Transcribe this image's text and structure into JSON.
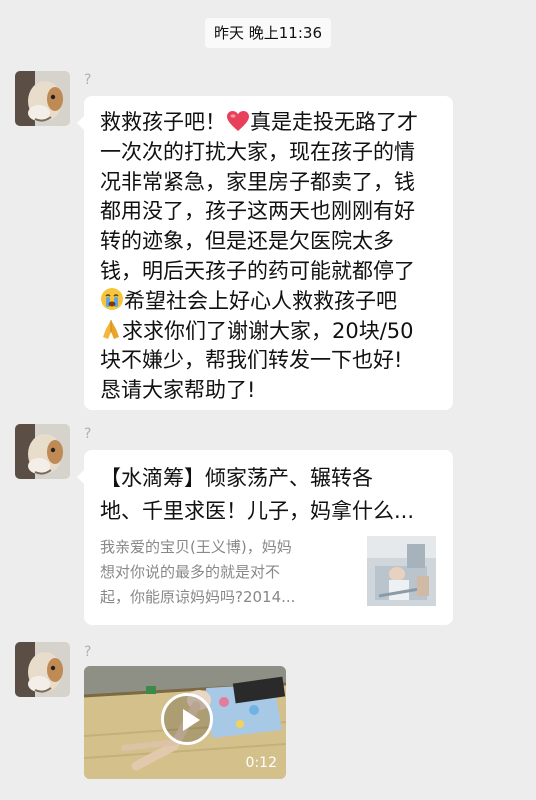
{
  "timestamp": "昨天 晚上11:36",
  "messages": [
    {
      "sender": "?",
      "lines": [
        "救救孩子吧！",
        "真是走投无路了才",
        "一次次的打扰大家，现在孩子的情",
        "况非常紧急，家里房子都卖了，钱",
        "都用没了，孩子这两天也刚刚有好",
        "转的迹象，但是还是欠医院太多",
        "钱，明后天孩子的药可能就都停了",
        "希望社会上好心人救救孩子吧",
        "求求你们了谢谢大家，20块/50",
        "块不嫌少，帮我们转发一下也好!",
        "恳请大家帮助了!"
      ],
      "emojis": [
        "red-heart",
        "crying-face",
        "folded-hands"
      ]
    },
    {
      "sender": "?",
      "card": {
        "title_lines": [
          "【水滴筹】倾家荡产、辗转各",
          "地、千里求医！儿子，妈拿什么..."
        ],
        "desc_lines": [
          "我亲爱的宝贝(王义博)，妈妈",
          "想对你说的最多的就是对不",
          "起，你能原谅妈妈吗?2014..."
        ]
      }
    },
    {
      "sender": "?",
      "video": {
        "duration": "0:12"
      }
    }
  ],
  "colors": {
    "background": "#ededed",
    "bubble": "#ffffff",
    "meta_text": "#b0b0b0",
    "heart": "#e8405a"
  }
}
